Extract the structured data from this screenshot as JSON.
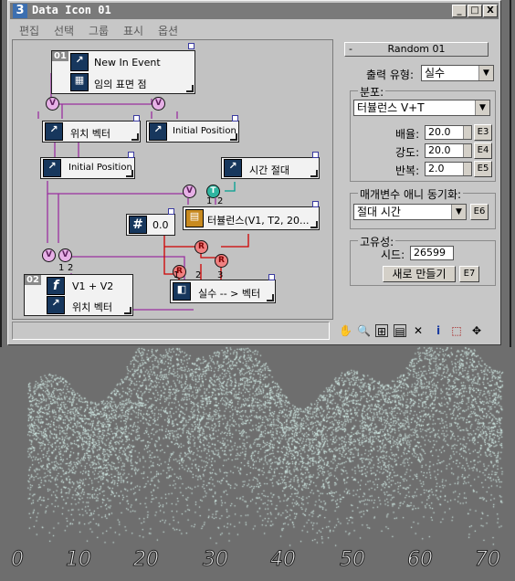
{
  "window": {
    "title": "Data Icon 01",
    "controls": [
      "_",
      "□",
      "X"
    ]
  },
  "menu": [
    "편집",
    "선택",
    "그룹",
    "표시",
    "옵션"
  ],
  "nodes": {
    "event": {
      "badge": "01",
      "line1": "New In Event",
      "line2": "임의 표면 점"
    },
    "pos_vector": {
      "label": "위치 벡터"
    },
    "init_pos_top": {
      "label": "Initial Position"
    },
    "init_pos_mid": {
      "label": "Initial Position"
    },
    "abs_time": {
      "label": "시간 절대"
    },
    "float_const": {
      "icon": "#",
      "label": "0.0"
    },
    "turbulence": {
      "label": "터뷸런스(V1, T2, 20..."
    },
    "func": {
      "badge": "02",
      "icon": "f",
      "line1": "V1 + V2",
      "line2": "위치 벡터"
    },
    "convert": {
      "label": "실수 -- > 벡터"
    }
  },
  "sockets": {
    "v": "V",
    "t": "T",
    "r": "R"
  },
  "port_numbers": {
    "n1": "1",
    "n2": "2",
    "n3": "3"
  },
  "panel": {
    "rollout_title": "Random 01",
    "output_type_label": "출력 유형:",
    "output_type_value": "실수",
    "distribution_group": "분포:",
    "distribution_value": "터뷸런스 V+T",
    "scale_label": "배율:",
    "scale_value": "20.0",
    "scale_btn": "E3",
    "strength_label": "강도:",
    "strength_value": "20.0",
    "strength_btn": "E4",
    "repeat_label": "반복:",
    "repeat_value": "2.0",
    "repeat_btn": "E5",
    "anim_sync_group": "매개변수 애니 동기화:",
    "anim_sync_value": "절대 시간",
    "anim_sync_btn": "E6",
    "uniqueness_group": "고유성:",
    "seed_label": "시드:",
    "seed_value": "26599",
    "new_button": "새로 만들기",
    "new_btn_e": "E7"
  },
  "toolbar_icons": [
    "pan-hand-icon",
    "zoom-icon",
    "zoom-region-icon",
    "fit-icon",
    "delete-icon",
    "info-icon",
    "select-icon",
    "move-icon"
  ],
  "viewport": {
    "axis_labels": [
      "0",
      "10",
      "20",
      "30",
      "40",
      "50",
      "60",
      "70"
    ],
    "particle_color": "#d8f4ee"
  },
  "colors": {
    "wire_purple": "#9a30a0",
    "wire_red": "#d00000",
    "wire_teal": "#00a090",
    "node_icon_blue": "#17375d"
  }
}
